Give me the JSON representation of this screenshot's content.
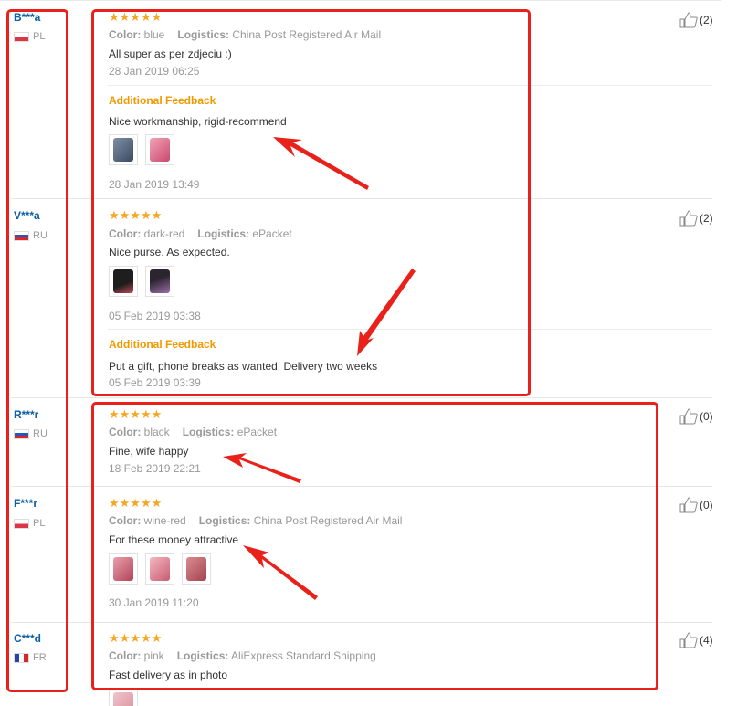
{
  "reviews": [
    {
      "user": "B***a",
      "country": "PL",
      "flag": "pl",
      "stars": "★★★★★",
      "color_label": "Color:",
      "color": "blue",
      "logistics_label": "Logistics:",
      "logistics": "China Post Registered Air Mail",
      "text": "All super as per zdjeciu :)",
      "date": "28 Jan 2019 06:25",
      "additional_label": "Additional Feedback",
      "additional_text": "Nice workmanship, rigid-recommend",
      "additional_date": "28 Jan 2019 13:49",
      "helpful": "(2)"
    },
    {
      "user": "V***a",
      "country": "RU",
      "flag": "ru",
      "stars": "★★★★★",
      "color_label": "Color:",
      "color": "dark-red",
      "logistics_label": "Logistics:",
      "logistics": "ePacket",
      "text": "Nice purse. As expected.",
      "date": "05 Feb 2019 03:38",
      "additional_label": "Additional Feedback",
      "additional_text": "Put a gift, phone breaks as wanted. Delivery two weeks",
      "additional_date": "05 Feb 2019 03:39",
      "helpful": "(2)"
    },
    {
      "user": "R***r",
      "country": "RU",
      "flag": "ru",
      "stars": "★★★★★",
      "color_label": "Color:",
      "color": "black",
      "logistics_label": "Logistics:",
      "logistics": "ePacket",
      "text": "Fine, wife happy",
      "date": "18 Feb 2019 22:21",
      "helpful": "(0)"
    },
    {
      "user": "F***r",
      "country": "PL",
      "flag": "pl",
      "stars": "★★★★★",
      "color_label": "Color:",
      "color": "wine-red",
      "logistics_label": "Logistics:",
      "logistics": "China Post Registered Air Mail",
      "text": "For these money attractive",
      "date": "30 Jan 2019 11:20",
      "helpful": "(0)"
    },
    {
      "user": "C***d",
      "country": "FR",
      "flag": "fr",
      "stars": "★★★★★",
      "color_label": "Color:",
      "color": "pink",
      "logistics_label": "Logistics:",
      "logistics": "AliExpress Standard Shipping",
      "text": "Fast delivery as in photo",
      "helpful": "(4)"
    }
  ],
  "icons": {
    "helpful": "thumbs-up-icon"
  },
  "colors": {
    "annotation_red": "#e8221a",
    "star_orange": "#f5a623",
    "feedback_orange": "#f39800",
    "username_blue": "#0b5fa5"
  }
}
